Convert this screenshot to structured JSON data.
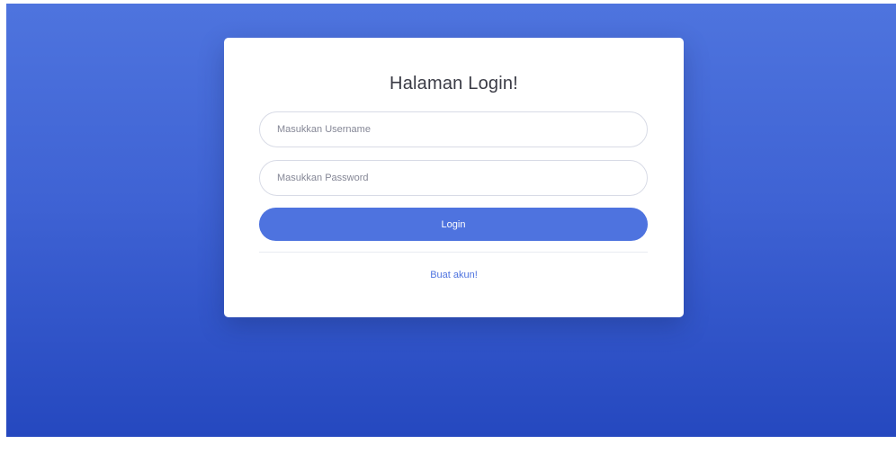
{
  "login_page": {
    "title": "Halaman Login!",
    "username_field": {
      "value": "",
      "placeholder": "Masukkan Username"
    },
    "password_field": {
      "value": "",
      "placeholder": "Masukkan Password"
    },
    "login_button_label": "Login",
    "register_link_label": "Buat akun!"
  },
  "colors": {
    "background_gradient_top": "#4e74de",
    "background_gradient_bottom": "#2548bf",
    "primary": "#4e73df",
    "card": "#ffffff"
  }
}
